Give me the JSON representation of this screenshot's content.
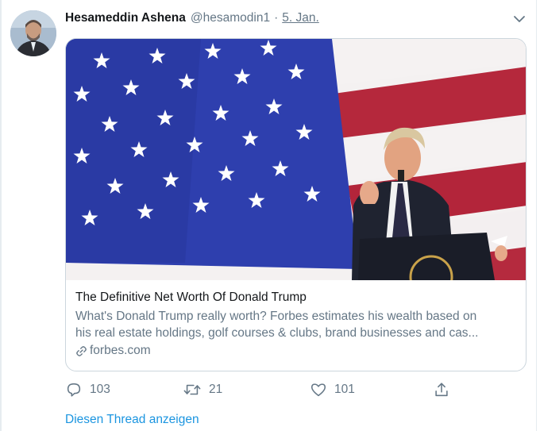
{
  "tweet": {
    "display_name": "Hesameddin Ashena",
    "handle": "@hesamodin1",
    "separator": "·",
    "date": "5. Jan."
  },
  "card": {
    "title": "The Definitive Net Worth Of Donald Trump",
    "description_line1": "What's Donald Trump really worth? Forbes estimates his wealth based on",
    "description_line2": "his real estate holdings, golf courses & clubs, brand businesses and cas...",
    "domain": "forbes.com"
  },
  "actions": {
    "reply_count": "103",
    "retweet_count": "21",
    "like_count": "101"
  },
  "thread_link": "Diesen Thread anzeigen",
  "icons": {
    "chevron": "chevron-down-icon",
    "reply": "reply-icon",
    "retweet": "retweet-icon",
    "like": "heart-icon",
    "share": "share-icon",
    "link": "link-icon"
  },
  "colors": {
    "secondary_text": "#657786",
    "link_blue": "#1b95e0",
    "border": "#ccd6dd",
    "flag_blue": "#2a3fa8",
    "flag_red": "#b22234"
  }
}
